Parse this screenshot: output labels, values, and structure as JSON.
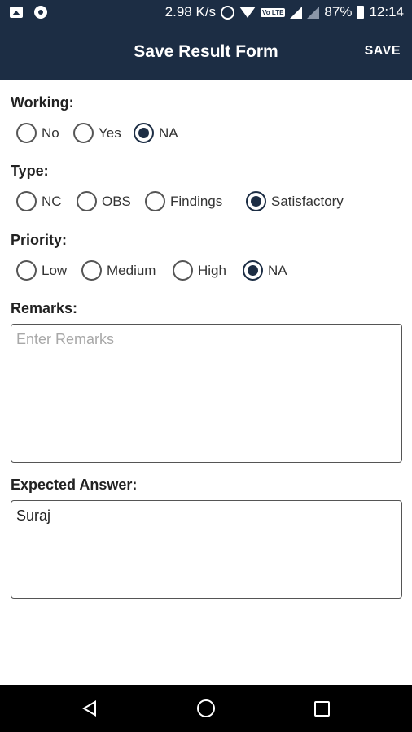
{
  "status_bar": {
    "speed": "2.98 K/s",
    "volte": "Vo LTE",
    "battery": "87%",
    "time": "12:14",
    "icons": [
      "image-icon",
      "circle-notification-icon",
      "alarm-icon",
      "wifi-icon",
      "signal-icon",
      "signal-empty-icon",
      "battery-icon"
    ]
  },
  "app_bar": {
    "title": "Save Result Form",
    "save_label": "SAVE"
  },
  "working": {
    "label": "Working:",
    "options": [
      "No",
      "Yes",
      "NA"
    ],
    "selected": "NA"
  },
  "type": {
    "label": "Type:",
    "options": [
      "NC",
      "OBS",
      "Findings",
      "Satisfactory"
    ],
    "selected": "Satisfactory"
  },
  "priority": {
    "label": "Priority:",
    "options": [
      "Low",
      "Medium",
      "High",
      "NA"
    ],
    "selected": "NA"
  },
  "remarks": {
    "label": "Remarks:",
    "placeholder": "Enter Remarks",
    "value": ""
  },
  "expected_answer": {
    "label": "Expected Answer:",
    "value": "Suraj"
  },
  "nav_bar": {
    "icons": [
      "back-icon",
      "home-icon",
      "recents-icon"
    ]
  },
  "colors": {
    "primary": "#1c2d44",
    "nav_bar": "#000000"
  }
}
